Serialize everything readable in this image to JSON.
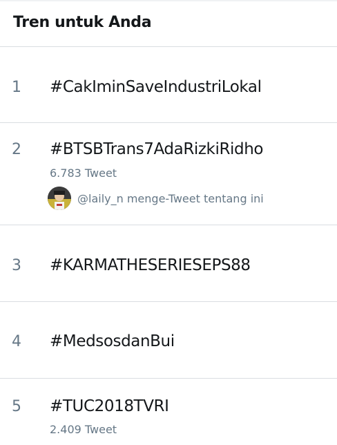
{
  "header": {
    "title": "Tren untuk Anda"
  },
  "trends": [
    {
      "rank": "1",
      "hashtag": "#CakIminSaveIndustriLokal"
    },
    {
      "rank": "2",
      "hashtag": "#BTSBTrans7AdaRizkiRidho",
      "tweet_count": "6.783 Tweet",
      "context": "@laily_n menge-Tweet tentang ini"
    },
    {
      "rank": "3",
      "hashtag": "#KARMATHESERIESEPS88"
    },
    {
      "rank": "4",
      "hashtag": "#MedsosdanBui"
    },
    {
      "rank": "5",
      "hashtag": "#TUC2018TVRI",
      "tweet_count": "2.409 Tweet"
    }
  ],
  "colors": {
    "primary_text": "#14171a",
    "secondary_text": "#657786",
    "divider": "#d9dde1",
    "background": "#ffffff"
  }
}
